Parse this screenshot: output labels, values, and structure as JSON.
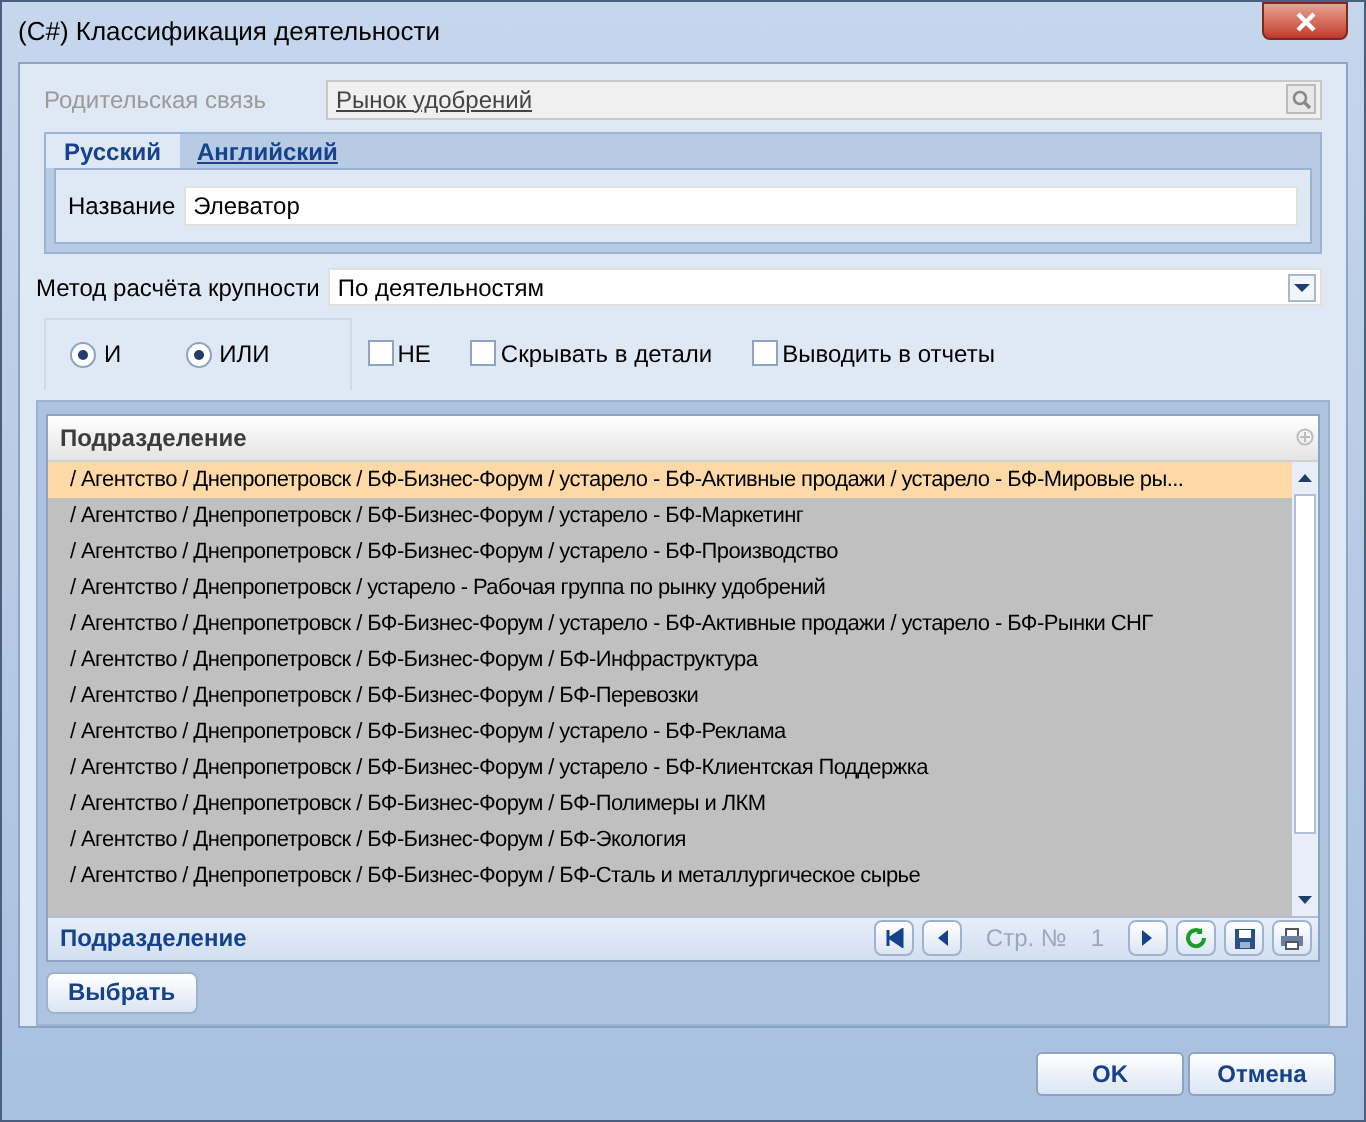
{
  "window": {
    "title": "(C#) Классификация деятельности"
  },
  "parent_link": {
    "label": "Родительская связь",
    "value": "Рынок удобрений",
    "disabled": true
  },
  "tabs": [
    {
      "label": "Русский",
      "selected": true
    },
    {
      "label": "Английский",
      "selected": false
    }
  ],
  "name_field": {
    "label": "Название",
    "value": "Элеватор"
  },
  "method": {
    "label": "Метод расчёта крупности",
    "value": "По деятельностям"
  },
  "options": [
    {
      "kind": "radio",
      "label": "И",
      "selected": true
    },
    {
      "kind": "radio",
      "label": "ИЛИ",
      "selected": true
    },
    {
      "kind": "checkbox",
      "label": "НЕ",
      "checked": false
    },
    {
      "kind": "checkbox",
      "label": "Скрывать в детали",
      "checked": false
    },
    {
      "kind": "checkbox",
      "label": "Выводить в отчеты",
      "checked": false
    }
  ],
  "grid": {
    "column": "Подразделение",
    "rows": [
      {
        "text": "/ Агентство / Днепропетровск / БФ-Бизнес-Форум / устарело - БФ-Активные продажи / устарело - БФ-Мировые ры...",
        "selected": true
      },
      {
        "text": "/ Агентство / Днепропетровск / БФ-Бизнес-Форум / устарело - БФ-Маркетинг",
        "selected": false
      },
      {
        "text": "/ Агентство / Днепропетровск / БФ-Бизнес-Форум / устарело - БФ-Производство",
        "selected": false
      },
      {
        "text": "/ Агентство / Днепропетровск / устарело -  Рабочая группа по рынку удобрений",
        "selected": false
      },
      {
        "text": "/ Агентство / Днепропетровск / БФ-Бизнес-Форум / устарело - БФ-Активные продажи / устарело - БФ-Рынки СНГ",
        "selected": false
      },
      {
        "text": "/ Агентство / Днепропетровск / БФ-Бизнес-Форум / БФ-Инфраструктура",
        "selected": false
      },
      {
        "text": "/ Агентство / Днепропетровск / БФ-Бизнес-Форум / БФ-Перевозки",
        "selected": false
      },
      {
        "text": "/ Агентство / Днепропетровск / БФ-Бизнес-Форум / устарело - БФ-Реклама",
        "selected": false
      },
      {
        "text": "/ Агентство / Днепропетровск / БФ-Бизнес-Форум / устарело - БФ-Клиентская Поддержка",
        "selected": false
      },
      {
        "text": "/ Агентство / Днепропетровск / БФ-Бизнес-Форум / БФ-Полимеры и ЛКМ",
        "selected": false
      },
      {
        "text": "/ Агентство / Днепропетровск / БФ-Бизнес-Форум / БФ-Экология",
        "selected": false
      },
      {
        "text": "/ Агентство / Днепропетровск / БФ-Бизнес-Форум / БФ-Сталь и металлургическое сырье",
        "selected": false
      }
    ],
    "footer_title": "Подразделение",
    "page_label": "Стр. №",
    "page": "1"
  },
  "select_button": "Выбрать",
  "buttons": [
    "OK",
    "Отмена"
  ]
}
